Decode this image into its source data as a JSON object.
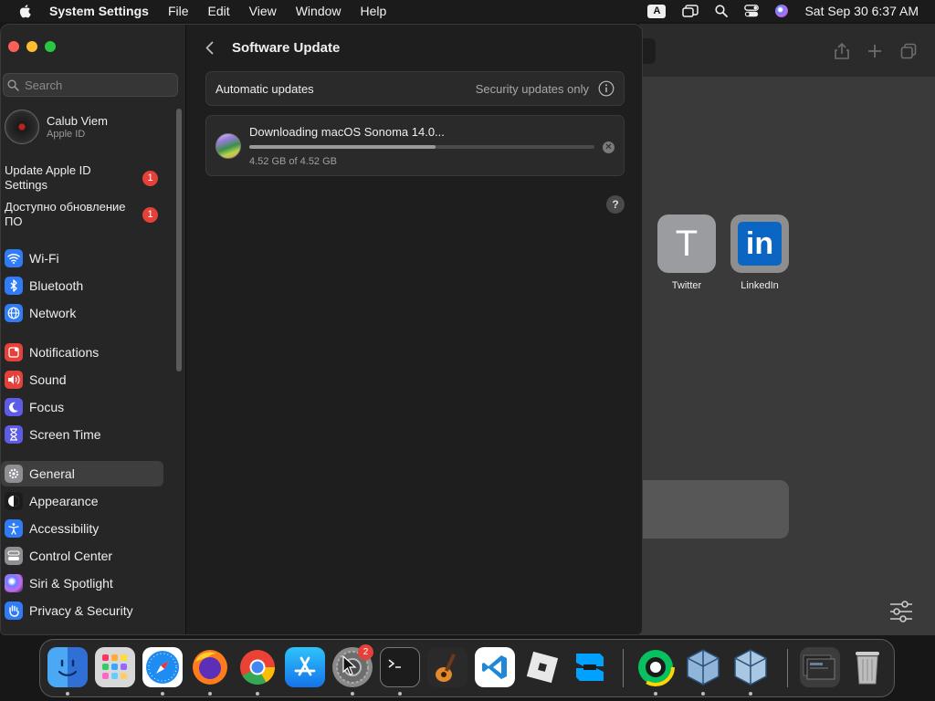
{
  "menubar": {
    "app_name": "System Settings",
    "menus": [
      "File",
      "Edit",
      "View",
      "Window",
      "Help"
    ],
    "input_source": "A",
    "datetime": "Sat Sep 30  6:37 AM"
  },
  "sidebar": {
    "search_placeholder": "Search",
    "profile": {
      "name": "Calub Viem",
      "subtitle": "Apple ID"
    },
    "alerts": [
      {
        "label": "Update Apple ID Settings",
        "badge": "1"
      },
      {
        "label": "Доступно обновление ПО",
        "badge": "1"
      }
    ],
    "items": [
      {
        "label": "Wi-Fi",
        "icon": "wifi-icon",
        "color": "#2f7cf6"
      },
      {
        "label": "Bluetooth",
        "icon": "bluetooth-icon",
        "color": "#2f7cf6"
      },
      {
        "label": "Network",
        "icon": "globe-icon",
        "color": "#2f7cf6"
      },
      {
        "label": "Notifications",
        "icon": "bell-icon",
        "color": "#e5413a"
      },
      {
        "label": "Sound",
        "icon": "speaker-icon",
        "color": "#e5413a"
      },
      {
        "label": "Focus",
        "icon": "moon-icon",
        "color": "#5e5ce6"
      },
      {
        "label": "Screen Time",
        "icon": "hourglass-icon",
        "color": "#5e5ce6"
      },
      {
        "label": "General",
        "icon": "gear-icon",
        "color": "#8e8e93"
      },
      {
        "label": "Appearance",
        "icon": "appearance-icon",
        "color": "#1c1c1e"
      },
      {
        "label": "Accessibility",
        "icon": "accessibility-icon",
        "color": "#2f7cf6"
      },
      {
        "label": "Control Center",
        "icon": "control-center-icon",
        "color": "#8e8e93"
      },
      {
        "label": "Siri & Spotlight",
        "icon": "siri-icon",
        "color": "#b84fd8"
      },
      {
        "label": "Privacy & Security",
        "icon": "hand-icon",
        "color": "#2f7cf6"
      }
    ],
    "active_item": "General"
  },
  "content": {
    "title": "Software Update",
    "automatic_updates": {
      "label": "Automatic updates",
      "value": "Security updates only"
    },
    "download": {
      "title": "Downloading macOS Sonoma 14.0...",
      "size_text": "4.52 GB of 4.52 GB",
      "progress": 0.54
    },
    "help_label": "?"
  },
  "background_app": {
    "tiles": [
      {
        "label": "Twitter",
        "glyph": "T"
      },
      {
        "label": "LinkedIn",
        "glyph": "in"
      }
    ]
  },
  "dock": {
    "apps": [
      {
        "name": "Finder",
        "icon": "finder-icon",
        "running": true
      },
      {
        "name": "Launchpad",
        "icon": "launchpad-icon",
        "running": false
      },
      {
        "name": "Safari",
        "icon": "safari-icon",
        "running": true
      },
      {
        "name": "Firefox",
        "icon": "firefox-icon",
        "running": true
      },
      {
        "name": "Chrome",
        "icon": "chrome-icon",
        "running": true
      },
      {
        "name": "App Store",
        "icon": "app-store-icon",
        "running": false
      },
      {
        "name": "System Settings",
        "icon": "system-settings-icon",
        "running": true,
        "badge": "2"
      },
      {
        "name": "Terminal",
        "icon": "terminal-icon",
        "running": true
      },
      {
        "name": "GarageBand",
        "icon": "garageband-icon",
        "running": false
      },
      {
        "name": "Visual Studio Code",
        "icon": "vscode-icon",
        "running": false
      },
      {
        "name": "Roblox",
        "icon": "roblox-icon",
        "running": false
      },
      {
        "name": "Roblox Studio",
        "icon": "roblox-studio-icon",
        "running": false
      },
      {
        "name": "Webex",
        "icon": "webex-icon",
        "running": true
      },
      {
        "name": "VirtualBox",
        "icon": "virtualbox-icon",
        "running": true
      },
      {
        "name": "VirtualBox VM",
        "icon": "virtualbox-vm-icon",
        "running": true
      },
      {
        "name": "Downloads",
        "icon": "downloads-stack-icon",
        "running": false
      },
      {
        "name": "Trash",
        "icon": "trash-icon",
        "running": false
      }
    ]
  }
}
